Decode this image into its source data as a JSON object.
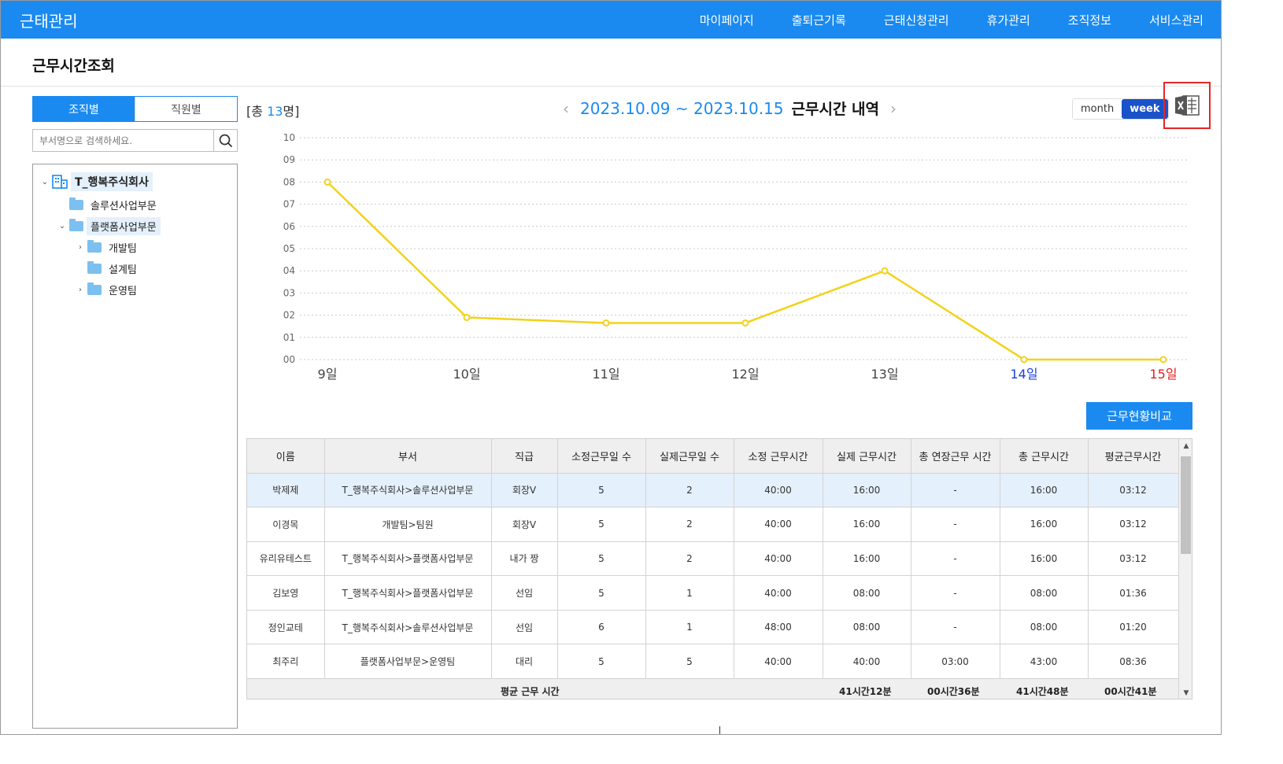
{
  "app": {
    "title": "근태관리"
  },
  "nav": [
    "마이페이지",
    "출퇴근기록",
    "근태신청관리",
    "휴가관리",
    "조직정보",
    "서비스관리"
  ],
  "page": {
    "title": "근무시간조회"
  },
  "left": {
    "tabs": {
      "org": "조직별",
      "emp": "직원별"
    },
    "search_placeholder": "부서명으로 검색하세요.",
    "tree": {
      "root": "T_행복주식회사",
      "items": [
        "솔루션사업부문",
        "플랫폼사업부문",
        "개발팀",
        "설계팀",
        "운영팀"
      ]
    }
  },
  "summary": {
    "prefix": "[총 ",
    "count": "13",
    "suffix": "명]"
  },
  "range": {
    "text": "2023.10.09 ~ 2023.10.15",
    "suffix": "근무시간 내역",
    "prev": "‹",
    "next": "›"
  },
  "view_toggle": {
    "month": "month",
    "week": "week",
    "selected": "week"
  },
  "excel_icon": "excel-export-icon",
  "colors": {
    "brand": "#1a8af0",
    "line": "#f2d21a",
    "saturday": "#1a3ee0",
    "sunday": "#e02020",
    "week_btn": "#1a52c9"
  },
  "chart_data": {
    "type": "line",
    "categories": [
      "9일",
      "10일",
      "11일",
      "12일",
      "13일",
      "14일",
      "15일"
    ],
    "values": [
      8,
      1.9,
      1.65,
      1.65,
      4,
      0,
      0
    ],
    "ylim": [
      0,
      10
    ],
    "yticks": [
      "00",
      "01",
      "02",
      "03",
      "04",
      "05",
      "06",
      "07",
      "08",
      "09",
      "10"
    ],
    "grid": true,
    "category_colors": [
      "#444444",
      "#444444",
      "#444444",
      "#444444",
      "#444444",
      "#1a3ee0",
      "#e02020"
    ]
  },
  "compare_button": "근무현황비교",
  "table": {
    "headers": [
      "이름",
      "부서",
      "직급",
      "소정근무일 수",
      "실제근무일 수",
      "소정 근무시간",
      "실제 근무시간",
      "총 연장근무 시간",
      "총 근무시간",
      "평균근무시간"
    ],
    "rows": [
      [
        "박제제",
        "T_행복주식회사>솔루션사업부문",
        "회장V",
        "5",
        "2",
        "40:00",
        "16:00",
        "-",
        "16:00",
        "03:12"
      ],
      [
        "이경목",
        "개발팀>팀원",
        "회장V",
        "5",
        "2",
        "40:00",
        "16:00",
        "-",
        "16:00",
        "03:12"
      ],
      [
        "유리유테스트",
        "T_행복주식회사>플랫폼사업부문",
        "내가 짱",
        "5",
        "2",
        "40:00",
        "16:00",
        "-",
        "16:00",
        "03:12"
      ],
      [
        "김보영",
        "T_행복주식회사>플랫폼사업부문",
        "선임",
        "5",
        "1",
        "40:00",
        "08:00",
        "-",
        "08:00",
        "01:36"
      ],
      [
        "정인교테",
        "T_행복주식회사>솔루션사업부문",
        "선임",
        "6",
        "1",
        "48:00",
        "08:00",
        "-",
        "08:00",
        "01:20"
      ],
      [
        "최주리",
        "플랫폼사업부문>운영팀",
        "대리",
        "5",
        "5",
        "40:00",
        "40:00",
        "03:00",
        "43:00",
        "08:36"
      ]
    ],
    "footer": {
      "label": "평균 근무 시간",
      "actual": "41시간12분",
      "overtime": "00시간36분",
      "total": "41시간48분",
      "avg": "00시간41분"
    }
  }
}
